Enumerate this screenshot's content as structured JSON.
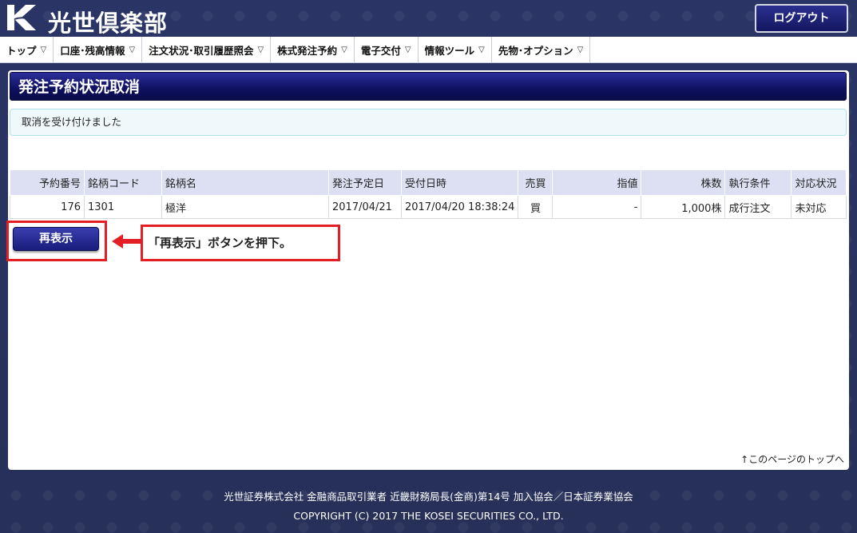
{
  "header": {
    "logo_text": "光世倶楽部",
    "logout_label": "ログアウト"
  },
  "nav": {
    "items": [
      {
        "label": "トップ"
      },
      {
        "label": "口座･残高情報"
      },
      {
        "label": "注文状況･取引履歴照会"
      },
      {
        "label": "株式発注予約"
      },
      {
        "label": "電子交付"
      },
      {
        "label": "情報ツール"
      },
      {
        "label": "先物･オプション"
      }
    ]
  },
  "page": {
    "title": "発注予約状況取消",
    "message": "取消を受け付けました"
  },
  "table": {
    "headers": [
      "予約番号",
      "銘柄コード",
      "銘柄名",
      "発注予定日",
      "受付日時",
      "売買",
      "指値",
      "株数",
      "執行条件",
      "対応状況"
    ],
    "rows": [
      [
        "176",
        "1301",
        "極洋",
        "2017/04/21",
        "2017/04/20 18:38:24",
        "買",
        "-",
        "1,000株",
        "成行注文",
        "未対応"
      ]
    ]
  },
  "actions": {
    "refresh_label": "再表示"
  },
  "annotation": {
    "callout_text": "「再表示」ボタンを押下。",
    "color": "#e31e24"
  },
  "page_top_link": "↑このページのトップへ",
  "footer": {
    "line1": "光世証券株式会社  金融商品取引業者  近畿財務局長(金商)第14号  加入協会／日本証券業協会",
    "line2": "COPYRIGHT (C) 2017 THE KOSEI SECURITIES CO., LTD."
  }
}
